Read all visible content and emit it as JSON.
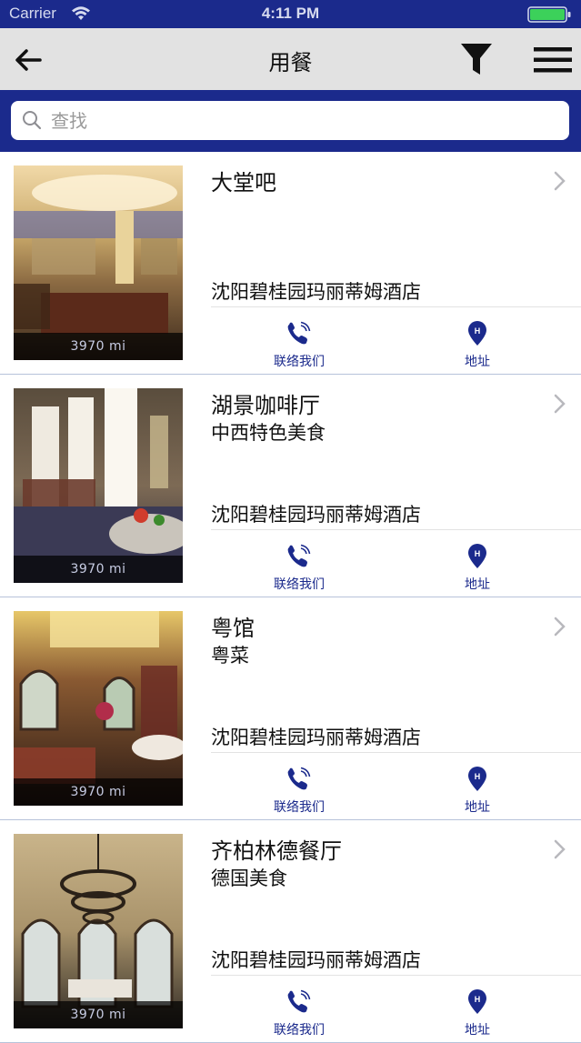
{
  "status": {
    "carrier": "Carrier",
    "time": "4:11 PM"
  },
  "nav": {
    "title": "用餐",
    "back_icon": "arrow-left-icon",
    "filter_icon": "filter-funnel-icon",
    "menu_icon": "hamburger-menu-icon"
  },
  "search": {
    "placeholder": "查找",
    "value": ""
  },
  "colors": {
    "brand_blue": "#1b2a8c",
    "nav_gray": "#e2e2e2",
    "divider": "#b7c3da"
  },
  "restaurants": [
    {
      "name": "大堂吧",
      "subtitle": "",
      "hotel": "沈阳碧桂园玛丽蒂姆酒店",
      "distance": "3970 mi",
      "call_label": "联络我们",
      "map_label": "地址"
    },
    {
      "name": "湖景咖啡厅",
      "subtitle": "中西特色美食",
      "hotel": "沈阳碧桂园玛丽蒂姆酒店",
      "distance": "3970 mi",
      "call_label": "联络我们",
      "map_label": "地址"
    },
    {
      "name": "粤馆",
      "subtitle": "粤菜",
      "hotel": "沈阳碧桂园玛丽蒂姆酒店",
      "distance": "3970 mi",
      "call_label": "联络我们",
      "map_label": "地址"
    },
    {
      "name": "齐柏林德餐厅",
      "subtitle": "德国美食",
      "hotel": "沈阳碧桂园玛丽蒂姆酒店",
      "distance": "3970 mi",
      "call_label": "联络我们",
      "map_label": "地址"
    }
  ]
}
